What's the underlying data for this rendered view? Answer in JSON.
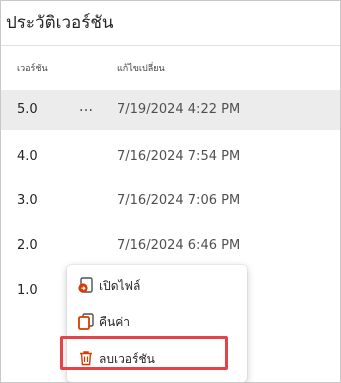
{
  "panel": {
    "title": "ประวัติเวอร์ชัน"
  },
  "table": {
    "headers": {
      "version": "เวอร์ชัน",
      "modified": "แก้ไขเปลี่ยน"
    },
    "more_label": "...",
    "rows": [
      {
        "version": "5.0",
        "modified": "7/19/2024 4:22 PM"
      },
      {
        "version": "4.0",
        "modified": "7/16/2024 7:54 PM"
      },
      {
        "version": "3.0",
        "modified": "7/16/2024 7:06 PM"
      },
      {
        "version": "2.0",
        "modified": "7/16/2024 6:46 PM"
      },
      {
        "version": "1.0",
        "modified": ""
      }
    ]
  },
  "context_menu": {
    "items": [
      {
        "label": "เปิดไฟล์",
        "icon": "open-file-icon"
      },
      {
        "label": "คืนค่า",
        "icon": "restore-icon"
      },
      {
        "label": "ลบเวอร์ชัน",
        "icon": "trash-icon"
      }
    ]
  },
  "colors": {
    "highlight_border": "#e4434a",
    "selected_row": "#ececec",
    "accent_orange": "#d83b01"
  }
}
